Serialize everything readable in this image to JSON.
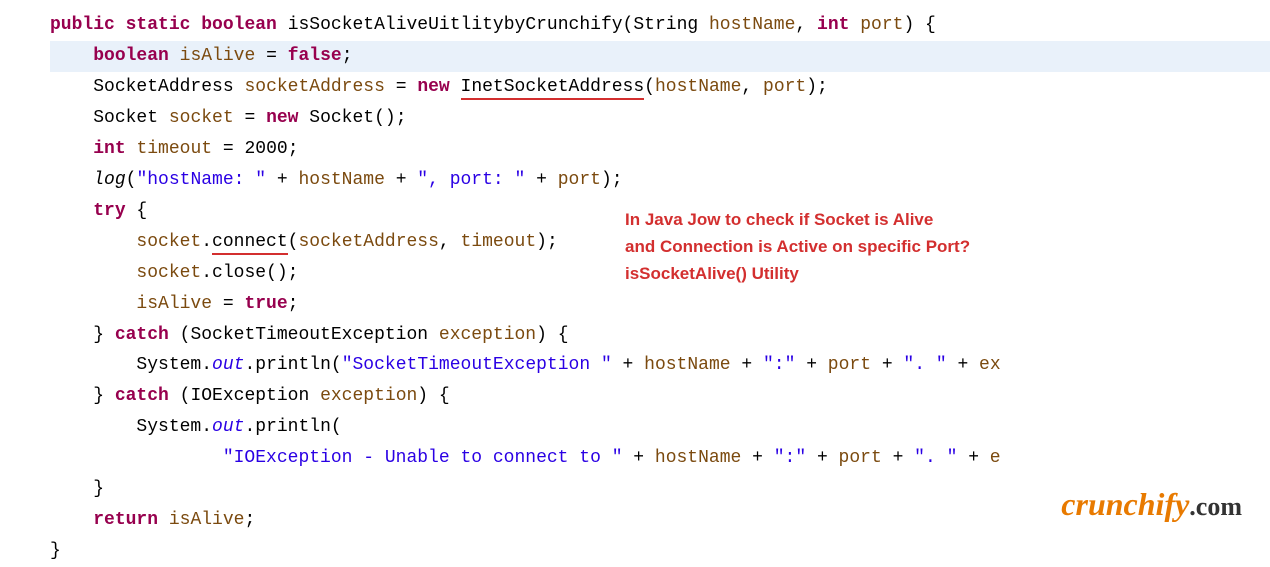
{
  "code": {
    "kw_public": "public",
    "kw_static": "static",
    "kw_boolean": "boolean",
    "method_name": "isSocketAliveUitlitybyCrunchify",
    "param_string": "String",
    "param_hostname": "hostName",
    "kw_int": "int",
    "param_port": "port",
    "var_isalive": "isAlive",
    "lit_false": "false",
    "type_socketaddress": "SocketAddress",
    "var_socketaddress": "socketAddress",
    "kw_new": "new",
    "type_inetsocket": "InetSocketAddress",
    "type_socket": "Socket",
    "var_socket": "socket",
    "ctor_socket": "Socket",
    "var_timeout": "timeout",
    "num_2000": "2000",
    "fn_log": "log",
    "str_hostname": "\"hostName: \"",
    "str_port_sep": "\", port: \"",
    "kw_try": "try",
    "method_connect": "connect",
    "method_close": "close",
    "lit_true": "true",
    "kw_catch": "catch",
    "type_ste": "SocketTimeoutException",
    "var_exception": "exception",
    "type_system": "System",
    "field_out": "out",
    "method_println": "println",
    "str_ste": "\"SocketTimeoutException \"",
    "str_colon": "\":\"",
    "str_dot_sp": "\". \"",
    "var_ex1": "ex",
    "type_ioe": "IOException",
    "str_ioe": "\"IOException - Unable to connect to \"",
    "var_e2": "e",
    "kw_return": "return"
  },
  "annotation": {
    "line1": "In Java Jow to check if Socket is Alive",
    "line2": "and Connection is Active on specific Port?",
    "line3": "isSocketAlive() Utility"
  },
  "logo": {
    "brand": "crunchify",
    "domain": ".com"
  }
}
